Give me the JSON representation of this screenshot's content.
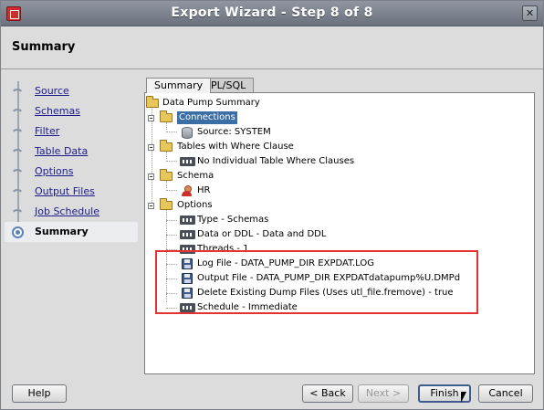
{
  "window": {
    "title": "Export Wizard - Step 8 of 8",
    "close_glyph": "✕"
  },
  "header": {
    "title": "Summary"
  },
  "steps": [
    {
      "label": "Source",
      "active": false
    },
    {
      "label": "Schemas",
      "active": false
    },
    {
      "label": "Filter",
      "active": false
    },
    {
      "label": "Table Data",
      "active": false
    },
    {
      "label": "Options",
      "active": false
    },
    {
      "label": "Output Files",
      "active": false
    },
    {
      "label": "Job Schedule",
      "active": false
    },
    {
      "label": "Summary",
      "active": true
    }
  ],
  "tabs": [
    {
      "label": "Summary",
      "active": true
    },
    {
      "label": "PL/SQL",
      "active": false
    }
  ],
  "tree": {
    "root": "Data Pump Summary",
    "connections": "Connections",
    "source": "Source: SYSTEM",
    "tables_where": "Tables with Where Clause",
    "no_where": "No Individual Table Where Clauses",
    "schema": "Schema",
    "schema_hr": "HR",
    "options": "Options",
    "type": "Type - Schemas",
    "data_ddl": "Data or DDL - Data and DDL",
    "threads": "Threads - 1",
    "log_file": "Log File - DATA_PUMP_DIR EXPDAT.LOG",
    "output_file": "Output File - DATA_PUMP_DIR EXPDATdatapump%U.DMPd",
    "delete_dump": "Delete Existing Dump Files (Uses utl_file.fremove) - true",
    "schedule": "Schedule - Immediate"
  },
  "buttons": {
    "help": "Help",
    "back": "< Back",
    "next": "Next >",
    "finish": "Finish",
    "cancel": "Cancel"
  },
  "colors": {
    "highlight_box": "#e23232",
    "selection": "#3b6ea5",
    "link": "#1b1b8a"
  }
}
